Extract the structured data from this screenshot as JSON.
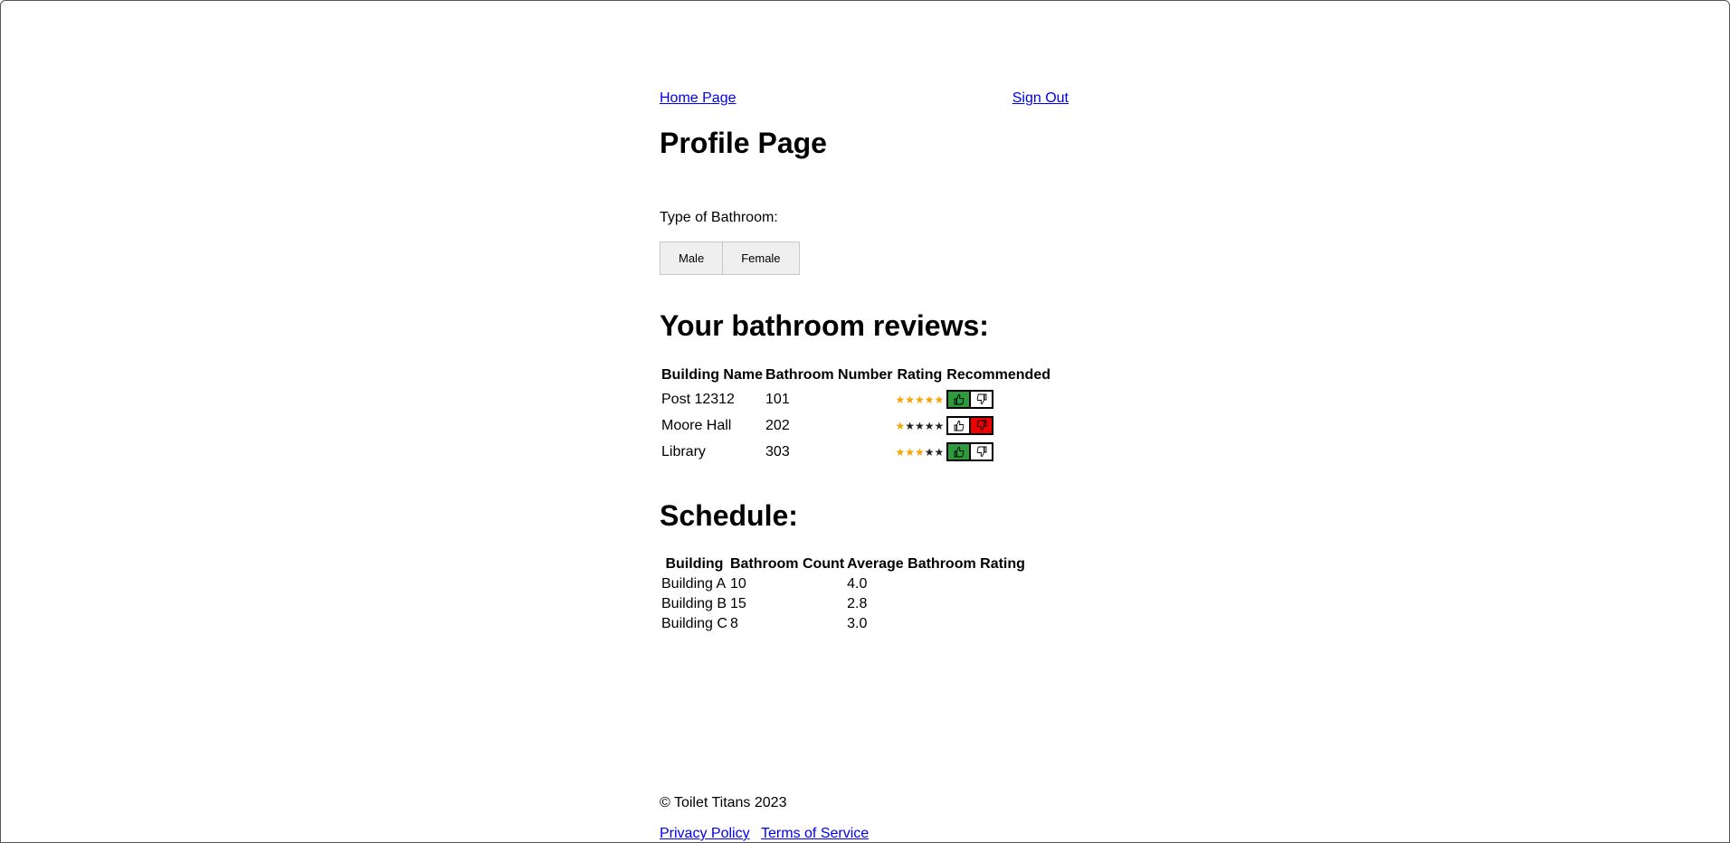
{
  "nav": {
    "home_label": "Home Page",
    "signout_label": "Sign Out"
  },
  "page_title": "Profile Page",
  "bathroom_type": {
    "label": "Type of Bathroom:",
    "options": [
      "Male",
      "Female"
    ]
  },
  "reviews": {
    "title": "Your bathroom reviews:",
    "headers": [
      "Building Name",
      "Bathroom Number",
      "Rating",
      "Recommended"
    ],
    "rows": [
      {
        "building": "Post 12312",
        "number": "101",
        "rating": 5,
        "recommended": "up"
      },
      {
        "building": "Moore Hall",
        "number": "202",
        "rating": 1,
        "recommended": "down"
      },
      {
        "building": "Library",
        "number": "303",
        "rating": 3,
        "recommended": "up"
      }
    ],
    "star_max": 5,
    "colors": {
      "star_on": "#f5a500",
      "star_off": "#222222",
      "thumb_up_active": "#2e9a3c",
      "thumb_down_active": "#ee0000"
    }
  },
  "schedule": {
    "title": "Schedule:",
    "headers": [
      "Building",
      "Bathroom Count",
      "Average Bathroom Rating"
    ],
    "rows": [
      [
        "Building A",
        "10",
        "4.0"
      ],
      [
        "Building B",
        "15",
        "2.8"
      ],
      [
        "Building C",
        "8",
        "3.0"
      ]
    ]
  },
  "footer": {
    "copyright": "© Toilet Titans 2023",
    "links": [
      "Privacy Policy",
      "Terms of Service"
    ]
  }
}
